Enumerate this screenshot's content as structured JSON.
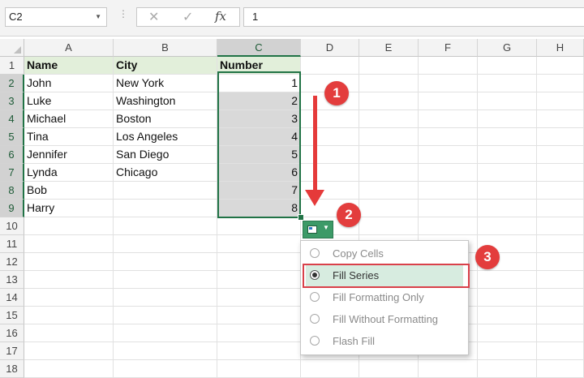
{
  "formula_bar": {
    "name_box": "C2",
    "cancel_icon": "✕",
    "enter_icon": "✓",
    "fx_label": "fx",
    "value": "1"
  },
  "columns": [
    "A",
    "B",
    "C",
    "D",
    "E",
    "F",
    "G",
    "H"
  ],
  "selected_column": "C",
  "rows": [
    "1",
    "2",
    "3",
    "4",
    "5",
    "6",
    "7",
    "8",
    "9",
    "10",
    "11",
    "12",
    "13",
    "14",
    "15",
    "16",
    "17",
    "18"
  ],
  "table": {
    "headers": {
      "name": "Name",
      "city": "City",
      "number": "Number"
    },
    "data": [
      {
        "name": "John",
        "city": "New York",
        "number": "1"
      },
      {
        "name": "Luke",
        "city": "Washington",
        "number": "2"
      },
      {
        "name": "Michael",
        "city": "Boston",
        "number": "3"
      },
      {
        "name": "Tina",
        "city": "Los Angeles",
        "number": "4"
      },
      {
        "name": "Jennifer",
        "city": "San Diego",
        "number": "5"
      },
      {
        "name": "Lynda",
        "city": "Chicago",
        "number": "6"
      },
      {
        "name": "Bob",
        "city": "",
        "number": "7"
      },
      {
        "name": "Harry",
        "city": "",
        "number": "8"
      }
    ]
  },
  "autofill_menu": {
    "items": [
      "Copy Cells",
      "Fill Series",
      "Fill Formatting Only",
      "Fill Without Formatting",
      "Flash Fill"
    ],
    "selected": "Fill Series"
  },
  "annotations": {
    "step1": "1",
    "step2": "2",
    "step3": "3"
  },
  "colors": {
    "excel_green": "#217346",
    "annotation_red": "#e33d3d",
    "header_fill": "#e2efda",
    "selection_fill": "#d9d9d9"
  }
}
